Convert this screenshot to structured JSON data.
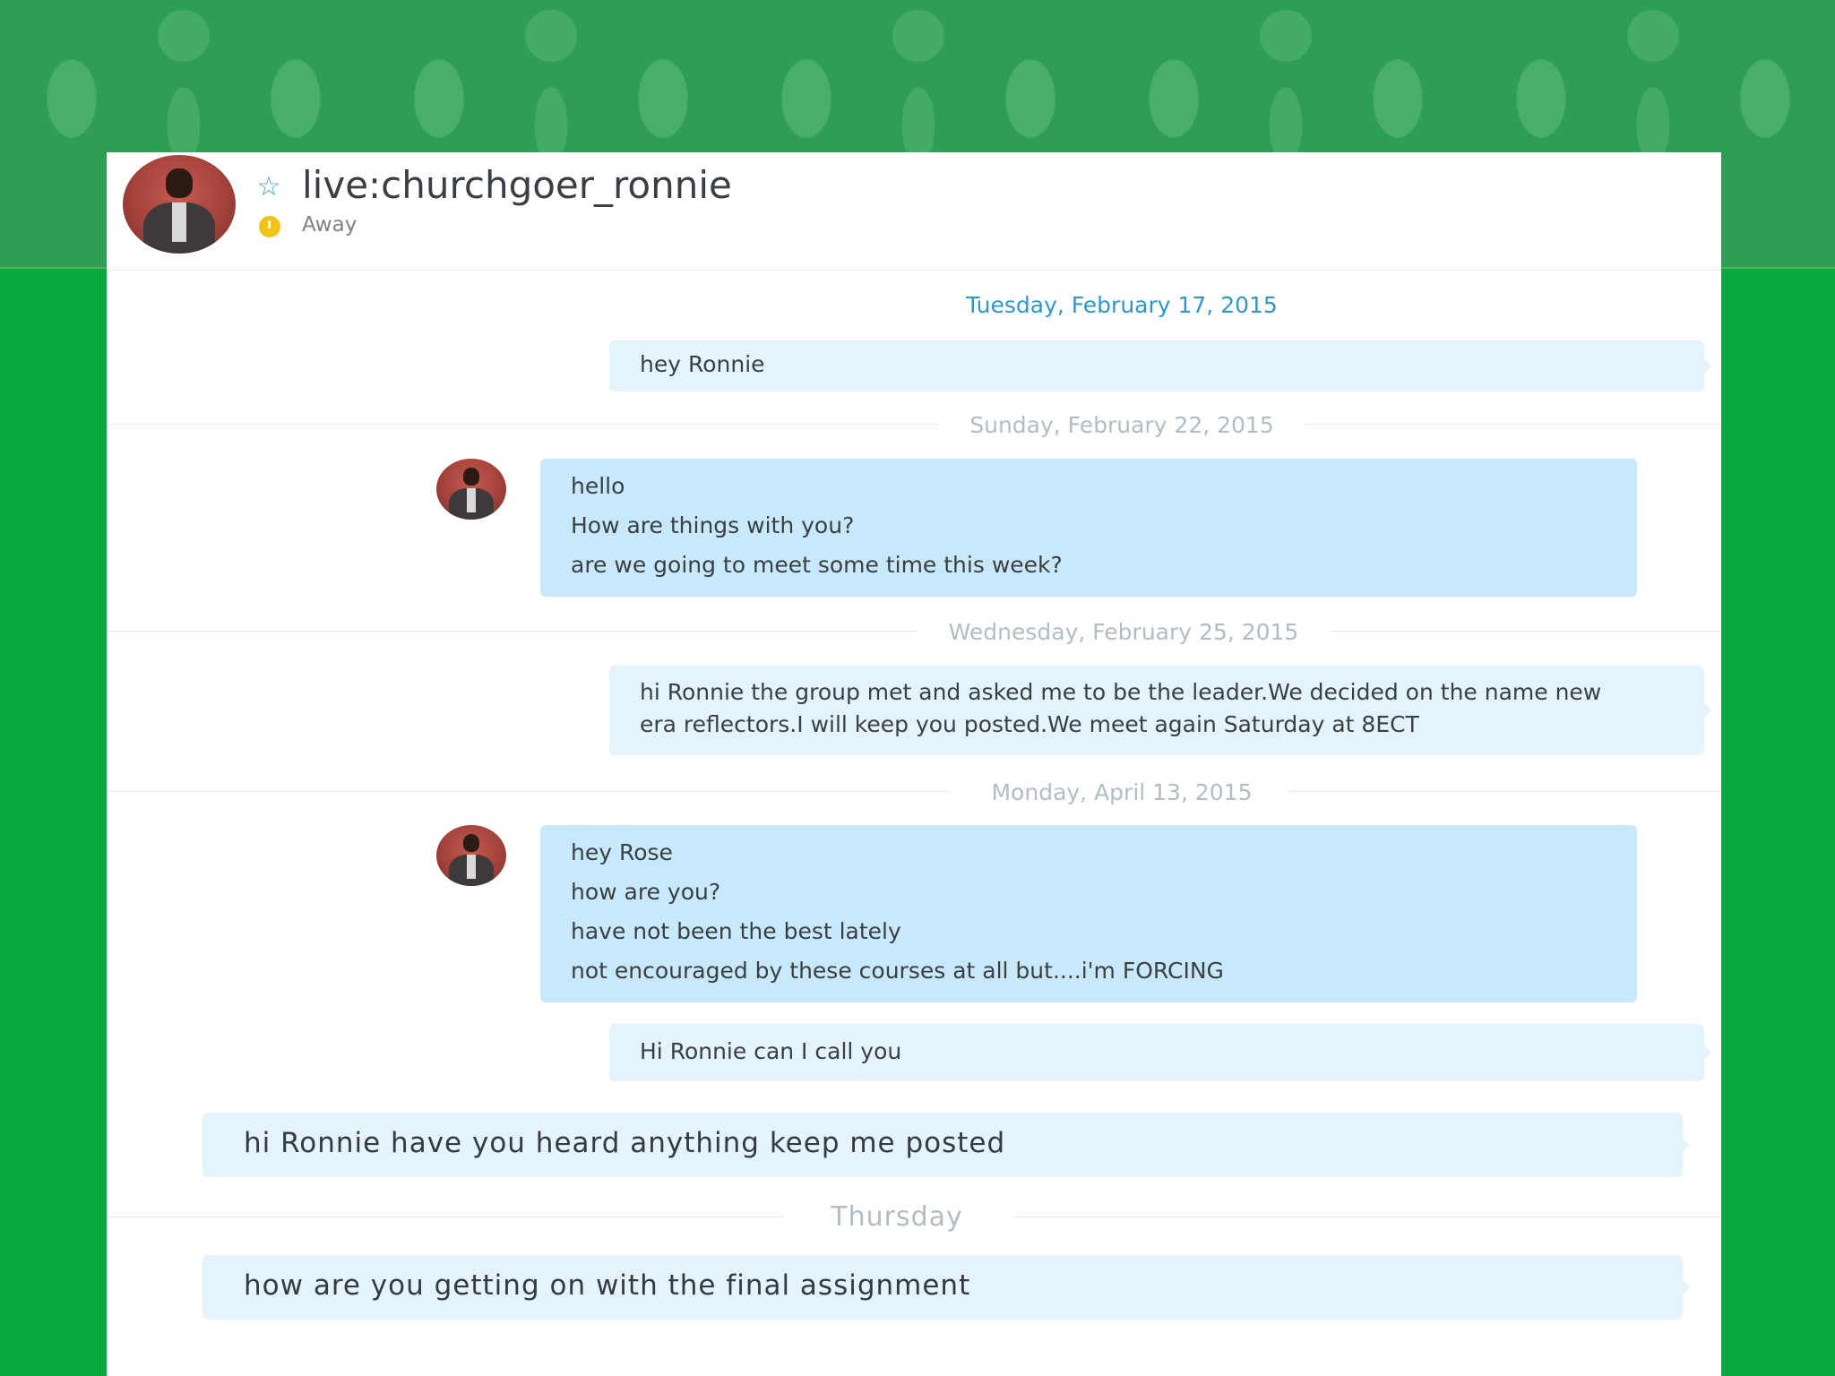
{
  "header": {
    "contact_name": "live:churchgoer_ronnie",
    "status": "Away"
  },
  "conversation": {
    "dates": [
      "Tuesday, February 17, 2015",
      "Sunday, February 22, 2015",
      "Wednesday, February 25, 2015",
      "Monday, April 13, 2015",
      "Thursday"
    ],
    "messages": [
      {
        "lines": [
          "hey Ronnie"
        ]
      },
      {
        "lines": [
          "hello",
          "How are things with you?",
          "are we going to meet some time this week?"
        ]
      },
      {
        "lines": [
          "hi Ronnie the group met and asked me to be the leader.We decided on the name new",
          "era reflectors.I will keep you posted.We meet again Saturday at 8ECT"
        ]
      },
      {
        "lines": [
          "hey Rose",
          "how are you?",
          "have not been the best lately",
          "not encouraged by these courses at all but....i'm FORCING"
        ]
      },
      {
        "lines": [
          "Hi Ronnie can I call you"
        ]
      },
      {
        "lines": [
          "hi Ronnie have you heard anything keep me posted"
        ]
      },
      {
        "lines": [
          "how are you getting on with the final assignment"
        ]
      }
    ]
  },
  "colors": {
    "background_green": "#08a83f",
    "banner_green": "#2f9e52",
    "outgoing_bubble": "#e5f4fc",
    "incoming_bubble": "#c8e9fb",
    "date_blue": "#3196c8",
    "away_yellow": "#f2c21a"
  },
  "icons": [
    "star-icon",
    "away-status-icon",
    "contact-avatar"
  ]
}
